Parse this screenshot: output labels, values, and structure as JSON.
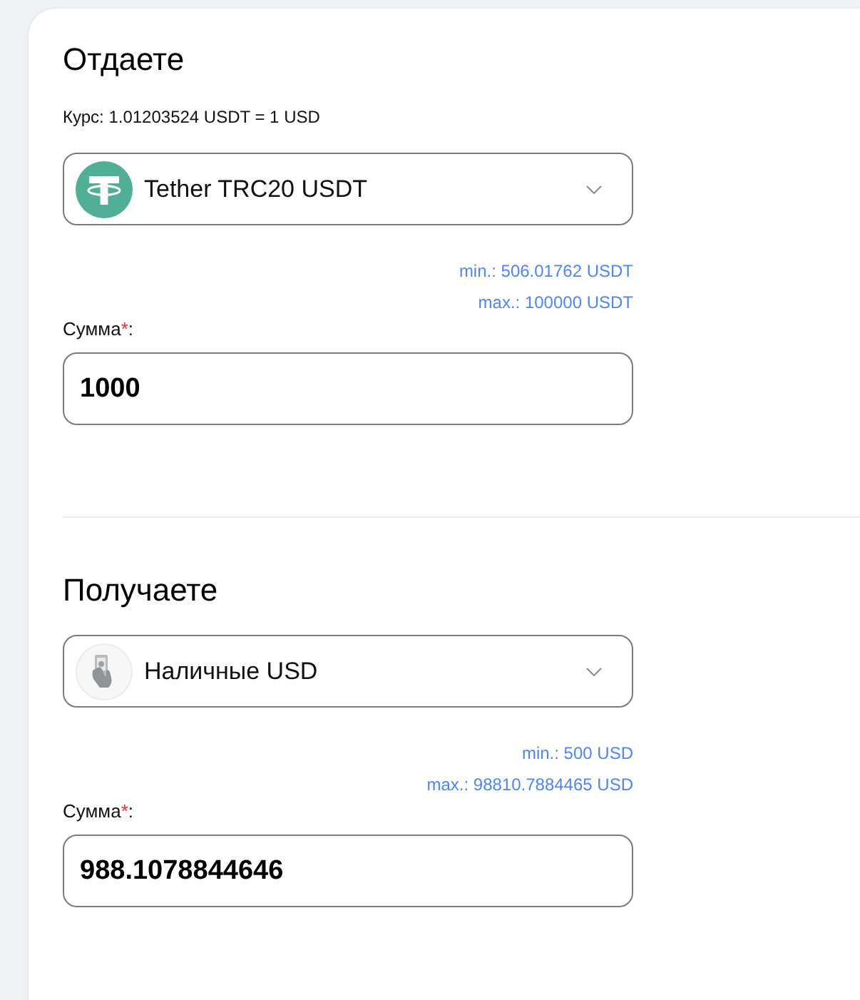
{
  "sections": [
    {
      "title": "Отдаете",
      "rate": "Курс: 1.01203524 USDT = 1 USD",
      "currency": {
        "kind": "tether",
        "name": "Tether TRC20 USDT"
      },
      "limits": [
        "min.: 506.01762 USDT",
        "max.: 100000 USDT"
      ],
      "amount": {
        "label": "Сумма",
        "required_mark": "*",
        "label_suffix": ":",
        "value": "1000"
      }
    },
    {
      "title": "Получаете",
      "currency": {
        "kind": "cash",
        "name": "Наличные USD"
      },
      "limits": [
        "min.: 500 USD",
        "max.: 98810.7884465 USD"
      ],
      "amount": {
        "label": "Сумма",
        "required_mark": "*",
        "label_suffix": ":",
        "value": "988.1078844646"
      }
    }
  ]
}
